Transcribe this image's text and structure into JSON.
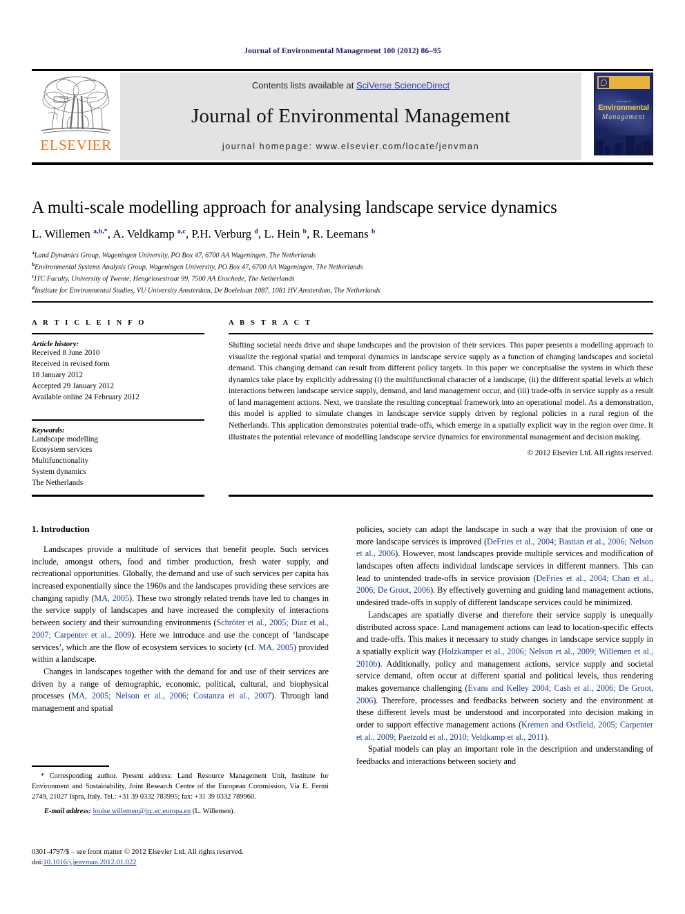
{
  "running_head": "Journal of Environmental Management 100 (2012) 86–95",
  "masthead": {
    "contents_prefix": "Contents lists available at ",
    "sciencedirect": "SciVerse ScienceDirect",
    "journal_name": "Journal of Environmental Management",
    "homepage": "journal homepage: www.elsevier.com/locate/jenvman",
    "publisher_wordmark": "ELSEVIER",
    "publisher_color": "#E87722",
    "link_color": "#2b3f9e",
    "band_color": "#e3e3e3",
    "cover": {
      "small_line": "Journal of",
      "title_line1": "Environmental",
      "title_line2": "Management",
      "bar_color": "#e8b33a",
      "bg_color": "#1b2663"
    }
  },
  "article": {
    "title": "A multi-scale modelling approach for analysing landscape service dynamics",
    "authors_html": "L. Willemen <sup>a,b,</sup><sup>*</sup>, A. Veldkamp <sup>a,c</sup>, P.H. Verburg <sup>d</sup>, L. Hein <sup>b</sup>, R. Leemans <sup>b</sup>",
    "affiliations": [
      {
        "marker": "a",
        "text": "Land Dynamics Group, Wageningen University, PO Box 47, 6700 AA Wageningen, The Netherlands"
      },
      {
        "marker": "b",
        "text": "Environmental Systems Analysis Group, Wageningen University, PO Box 47, 6700 AA Wageningen, The Netherlands"
      },
      {
        "marker": "c",
        "text": "ITC Faculty, University of Twente, Hengelosestraat 99, 7500 AA Enschede, The Netherlands"
      },
      {
        "marker": "d",
        "text": "Institute for Environmental Studies, VU University Amsterdam, De Boelelaan 1087, 1081 HV Amsterdam, The Netherlands"
      }
    ]
  },
  "article_info": {
    "heading": "A R T I C L E    I N F O",
    "history_label": "Article history:",
    "history": [
      "Received 8 June 2010",
      "Received in revised form",
      "18 January 2012",
      "Accepted 29 January 2012",
      "Available online 24 February 2012"
    ],
    "keywords_label": "Keywords:",
    "keywords": [
      "Landscape modelling",
      "Ecosystem services",
      "Multifunctionality",
      "System dynamics",
      "The Netherlands"
    ]
  },
  "abstract": {
    "heading": "A B S T R A C T",
    "text": "Shifting societal needs drive and shape landscapes and the provision of their services. This paper presents a modelling approach to visualize the regional spatial and temporal dynamics in landscape service supply as a function of changing landscapes and societal demand. This changing demand can result from different policy targets. In this paper we conceptualise the system in which these dynamics take place by explicitly addressing (i) the multifunctional character of a landscape, (ii) the different spatial levels at which interactions between landscape service supply, demand, and land management occur, and (iii) trade-offs in service supply as a result of land management actions. Next, we translate the resulting conceptual framework into an operational model. As a demonstration, this model is applied to simulate changes in landscape service supply driven by regional policies in a rural region of the Netherlands. This application demonstrates potential trade-offs, which emerge in a spatially explicit way in the region over time. It illustrates the potential relevance of modelling landscape service dynamics for environmental management and decision making.",
    "copyright": "© 2012 Elsevier Ltd. All rights reserved."
  },
  "body": {
    "section_title": "1. Introduction",
    "left_paragraphs": [
      "Landscapes provide a multitude of services that benefit people. Such services include, amongst others, food and timber production, fresh water supply, and recreational opportunities. Globally, the demand and use of such services per capita has increased exponentially since the 1960s and the landscapes providing these services are changing rapidly (MA, 2005). These two strongly related trends have led to changes in the service supply of landscapes and have increased the complexity of interactions between society and their surrounding environments (Schröter et al., 2005; Diaz et al., 2007; Carpenter et al., 2009). Here we introduce and use the concept of ‘landscape services’, which are the flow of ecosystem services to society (cf. MA, 2005) provided within a landscape.",
      "Changes in landscapes together with the demand for and use of their services are driven by a range of demographic, economic, political, cultural, and biophysical processes (MA, 2005; Nelson et al., 2006; Costanza et al., 2007). Through land management and spatial"
    ],
    "right_paragraphs": [
      "policies, society can adapt the landscape in such a way that the provision of one or more landscape services is improved (DeFries et al., 2004; Bastian et al., 2006; Nelson et al., 2006). However, most landscapes provide multiple services and modification of landscapes often affects individual landscape services in different manners. This can lead to unintended trade-offs in service provision (DeFries et al., 2004; Chan et al., 2006; De Groot, 2006). By effectively governing and guiding land management actions, undesired trade-offs in supply of different landscape services could be minimized.",
      "Landscapes are spatially diverse and therefore their service supply is unequally distributed across space. Land management actions can lead to location-specific effects and trade-offs. This makes it necessary to study changes in landscape service supply in a spatially explicit way (Holzkamper et al., 2006; Nelson et al., 2009; Willemen et al., 2010b). Additionally, policy and management actions, service supply and societal service demand, often occur at different spatial and political levels, thus rendering makes governance challenging (Evans and Kelley 2004; Cash et al., 2006; De Groot, 2006). Therefore, processes and feedbacks between society and the environment at these different levels must be understood and incorporated into decision making in order to support effective management actions (Kremen and Ostfield, 2005; Carpenter et al., 2009; Paetzold et al., 2010; Veldkamp et al., 2011).",
      "Spatial models can play an important role in the description and understanding of feedbacks and interactions between society and"
    ]
  },
  "footnote": {
    "corresponding": "* Corresponding author. Present address: Land Resource Management Unit, Institute for Environment and Sustainability, Joint Research Centre of the European Commission, Via E. Fermi 2749, 21027 Ispra, Italy. Tel.: +31 39 0332 783995; fax: +31 39 0332 789960.",
    "email_label": "E-mail address:",
    "email": "louise.willemen@jrc.ec.europa.eu",
    "email_suffix": "(L. Willemen)."
  },
  "colophon": {
    "line1": "0301-4797/$ – see front matter © 2012 Elsevier Ltd. All rights reserved.",
    "doi_prefix": "doi:",
    "doi": "10.1016/j.jenvman.2012.01.022"
  }
}
